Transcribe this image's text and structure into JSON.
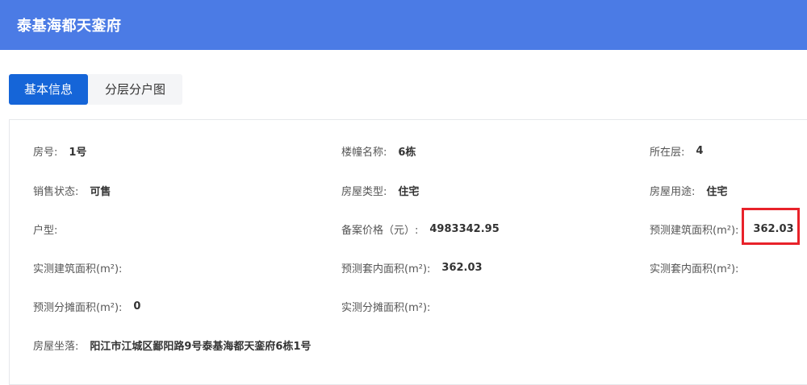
{
  "header": {
    "title": "泰基海都天銮府"
  },
  "tabs": [
    {
      "label": "基本信息"
    },
    {
      "label": "分层分户图"
    }
  ],
  "fields": {
    "room_no": {
      "label": "房号:",
      "value": "1号"
    },
    "building_name": {
      "label": "楼幢名称:",
      "value": "6栋"
    },
    "floor": {
      "label": "所在层:",
      "value": "4"
    },
    "sale_status": {
      "label": "销售状态:",
      "value": "可售"
    },
    "house_type": {
      "label": "房屋类型:",
      "value": "住宅"
    },
    "house_use": {
      "label": "房屋用途:",
      "value": "住宅"
    },
    "layout": {
      "label": "户型:",
      "value": ""
    },
    "filed_price": {
      "label": "备案价格（元）:",
      "value": "4983342.95"
    },
    "pred_building_area": {
      "label": "预测建筑面积(m²):",
      "value": "362.03"
    },
    "actual_building_area": {
      "label": "实测建筑面积(m²):",
      "value": ""
    },
    "pred_inner_area": {
      "label": "预测套内面积(m²):",
      "value": "362.03"
    },
    "actual_inner_area": {
      "label": "实测套内面积(m²):",
      "value": ""
    },
    "pred_shared_area": {
      "label": "预测分摊面积(m²):",
      "value": "0"
    },
    "actual_shared_area": {
      "label": "实测分摊面积(m²):",
      "value": ""
    },
    "address": {
      "label": "房屋坐落:",
      "value": "阳江市江城区鄙阳路9号泰基海都天銮府6栋1号"
    }
  },
  "colors": {
    "header_bg": "#4b7be5",
    "tab_active": "#1565d8",
    "highlight_border": "#e8222a"
  }
}
